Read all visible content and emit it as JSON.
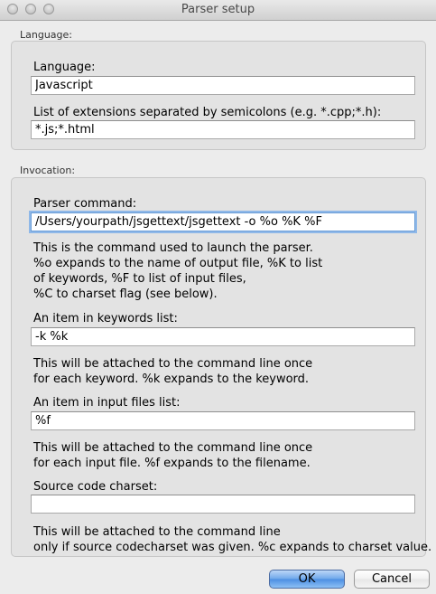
{
  "window": {
    "title": "Parser setup"
  },
  "language_section": {
    "label": "Language:",
    "language_label": "Language:",
    "language_value": "Javascript",
    "extensions_label": "List of extensions separated by semicolons (e.g. *.cpp;*.h):",
    "extensions_value": "*.js;*.html"
  },
  "invocation_section": {
    "label": "Invocation:",
    "parser_command_label": "Parser command:",
    "parser_command_value": "/Users/yourpath/jsgettext/jsgettext -o %o %K %F",
    "parser_command_help": "This is the command used to launch the parser.\n%o expands to the name of output file, %K to list\nof keywords, %F to list of input files,\n%C to charset flag (see below).",
    "keywords_label": "An item in keywords list:",
    "keywords_value": "-k %k",
    "keywords_help": "This will be attached to the command line once\nfor each keyword. %k expands to the keyword.",
    "input_files_label": "An item in input files list:",
    "input_files_value": "%f",
    "input_files_help": "This will be attached to the command line once\nfor each input file. %f expands to the filename.",
    "charset_label": "Source code charset:",
    "charset_value": "",
    "charset_help": "This will be attached to the command line\nonly if source codecharset was given. %c expands to charset value."
  },
  "buttons": {
    "ok_label": "OK",
    "cancel_label": "Cancel"
  }
}
